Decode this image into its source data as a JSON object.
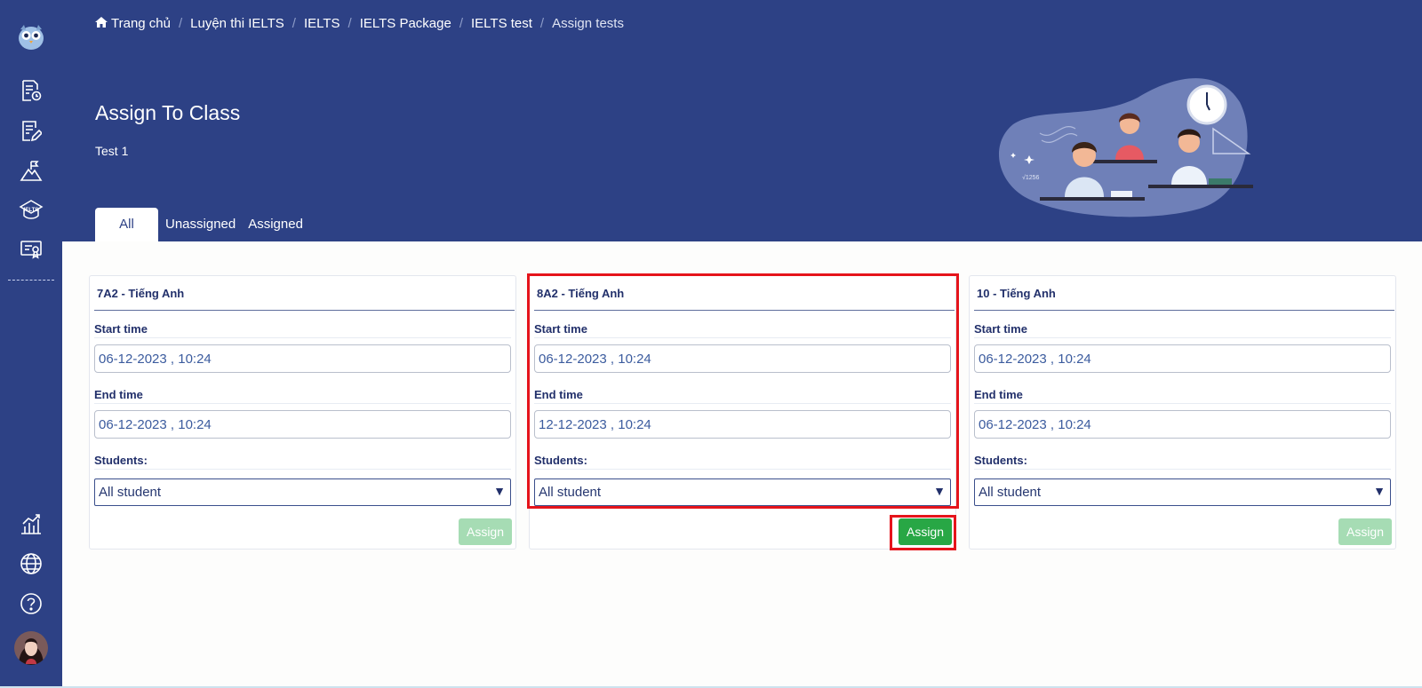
{
  "breadcrumb": {
    "home": "Trang chủ",
    "items": [
      "Luyện thi IELTS",
      "IELTS",
      "IELTS Package",
      "IELTS test",
      "Assign tests"
    ]
  },
  "page": {
    "title": "Assign To Class",
    "test_name": "Test 1"
  },
  "tabs": [
    "All",
    "Unassigned",
    "Assigned"
  ],
  "active_tab": "All",
  "labels": {
    "start_time": "Start time",
    "end_time": "End time",
    "students": "Students:",
    "assign": "Assign"
  },
  "cards": [
    {
      "class_name": "7A2 - Tiếng Anh",
      "start_time": "06-12-2023 , 10:24",
      "end_time": "06-12-2023 , 10:24",
      "students": "All student",
      "assign_enabled": false,
      "highlighted": false
    },
    {
      "class_name": "8A2 - Tiếng Anh",
      "start_time": "06-12-2023 , 10:24",
      "end_time": "12-12-2023 , 10:24",
      "students": "All student",
      "assign_enabled": true,
      "highlighted": true
    },
    {
      "class_name": "10 - Tiếng Anh",
      "start_time": "06-12-2023 , 10:24",
      "end_time": "06-12-2023 , 10:24",
      "students": "All student",
      "assign_enabled": false,
      "highlighted": false
    }
  ],
  "sidebar": {
    "icons": [
      "owl-logo-icon",
      "test-list-icon",
      "edit-document-icon",
      "mountain-flag-icon",
      "ielts-icon",
      "certificate-icon",
      "chart-icon",
      "globe-icon",
      "help-icon",
      "avatar"
    ],
    "ielts_icon_text": "IELTS"
  },
  "colors": {
    "primary": "#2d4185",
    "assign_enabled": "#28a745",
    "assign_disabled": "#a6dcb4",
    "highlight": "#e5141b"
  }
}
